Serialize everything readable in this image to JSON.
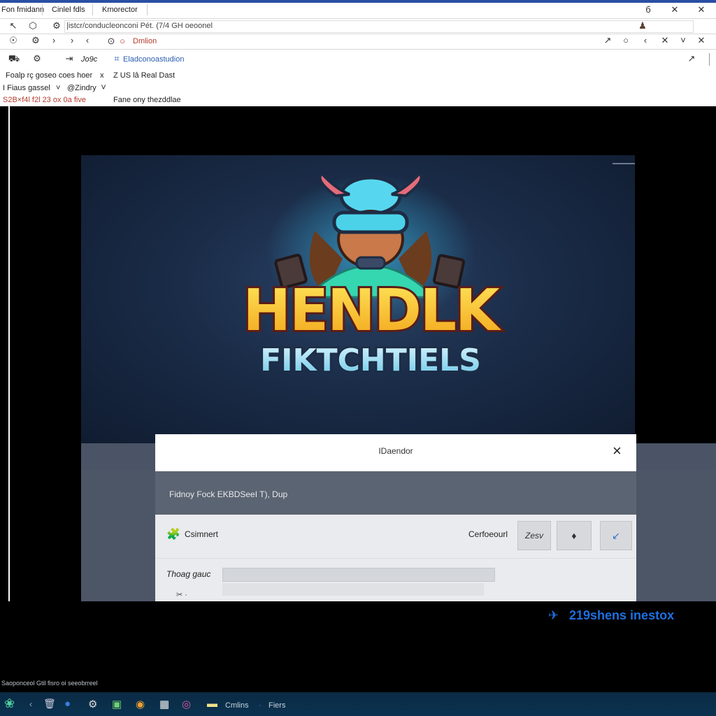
{
  "tabs": [
    "Fon fmidann",
    "Cinlel fdls",
    "Kmorector"
  ],
  "window_controls": {
    "minimize": "б",
    "maximize": "✕",
    "close": "✕"
  },
  "address": {
    "text": "|istcr/conducleonconi Pét. (7/4 GH oeoonel"
  },
  "address_right_icon": "person-icon",
  "toolbar1": {
    "label": "Dmlion"
  },
  "toolbar2": {
    "item_a": "Jo9c",
    "item_b": "Eladconoastudion"
  },
  "info_rows": [
    {
      "left": "Foalp rç goseo coes hoer",
      "x": "x",
      "right": "Z US lâ Real Dast"
    },
    {
      "left": "I Fiaus gassel",
      "chev": "˅",
      "right": "@Zindry"
    },
    {
      "left": "S2B×f4l  f2l 23 ox 0a five",
      "right": "Fane ony thezddlae"
    }
  ],
  "game_logo": {
    "title": "HENDLK",
    "subtitle": "FIKTCHTIELS"
  },
  "dialog": {
    "title": "IDaendor",
    "close": "×",
    "subtitle": "Fidnoy Fock EKBDSeeI T), Dup",
    "row_label": "Csimnert",
    "row_right_label": "Cerfoeourl",
    "btn_text": "Zesv",
    "field_label": "Thoag gauc"
  },
  "watermark": "219shens inestox",
  "status_line": "Saoponceol  Gtil  fisro oi seeobrreel",
  "taskbar": {
    "item_1": "Cmlins",
    "item_2": "Fiers"
  },
  "colors": {
    "accent": "#2a4fa3",
    "link_red": "#b43a2e",
    "watermark_blue": "#1e6fe0"
  }
}
